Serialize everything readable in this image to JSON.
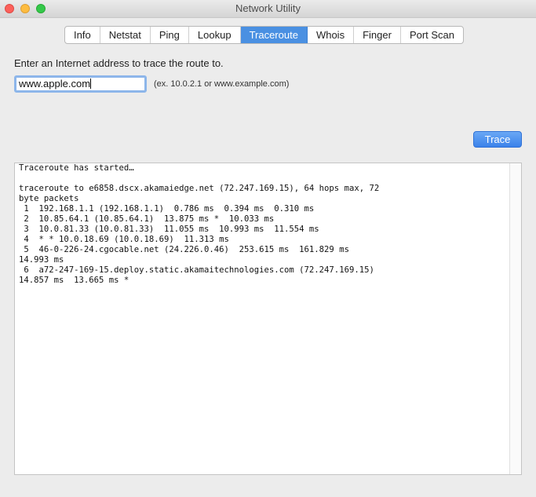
{
  "window": {
    "title": "Network Utility"
  },
  "tabs": [
    {
      "label": "Info"
    },
    {
      "label": "Netstat"
    },
    {
      "label": "Ping"
    },
    {
      "label": "Lookup"
    },
    {
      "label": "Traceroute"
    },
    {
      "label": "Whois"
    },
    {
      "label": "Finger"
    },
    {
      "label": "Port Scan"
    }
  ],
  "active_tab": "Traceroute",
  "traceroute": {
    "prompt": "Enter an Internet address to trace the route to.",
    "address_value": "www.apple.com",
    "hint": "(ex. 10.0.2.1 or www.example.com)",
    "trace_button": "Trace",
    "output_lines": [
      "Traceroute has started…",
      "",
      "traceroute to e6858.dscx.akamaiedge.net (72.247.169.15), 64 hops max, 72",
      "byte packets",
      " 1  192.168.1.1 (192.168.1.1)  0.786 ms  0.394 ms  0.310 ms",
      " 2  10.85.64.1 (10.85.64.1)  13.875 ms *  10.033 ms",
      " 3  10.0.81.33 (10.0.81.33)  11.055 ms  10.993 ms  11.554 ms",
      " 4  * * 10.0.18.69 (10.0.18.69)  11.313 ms",
      " 5  46-0-226-24.cgocable.net (24.226.0.46)  253.615 ms  161.829 ms",
      "14.993 ms",
      " 6  a72-247-169-15.deploy.static.akamaitechnologies.com (72.247.169.15)",
      "14.857 ms  13.665 ms *"
    ]
  },
  "colors": {
    "accent": "#4a90e2",
    "close": "#fc605b",
    "minimize": "#fdbc40",
    "maximize": "#34c84a"
  }
}
